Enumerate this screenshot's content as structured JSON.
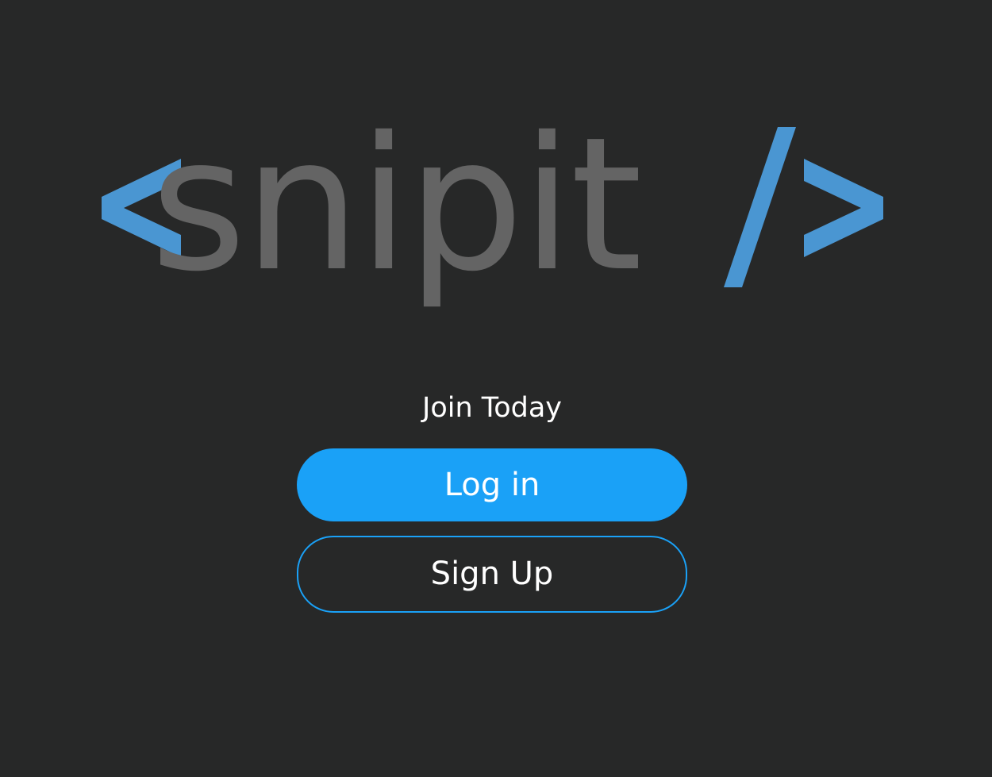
{
  "logo": {
    "open_bracket": "<",
    "word": "snipit",
    "slash": "/",
    "close_bracket": ">",
    "bracket_color": "#4a96d2",
    "word_color": "#646464"
  },
  "tagline": "Join Today",
  "actions": {
    "login_label": "Log in",
    "signup_label": "Sign Up"
  },
  "colors": {
    "background": "#272828",
    "accent": "#1aa1f7",
    "text": "#ffffff"
  }
}
